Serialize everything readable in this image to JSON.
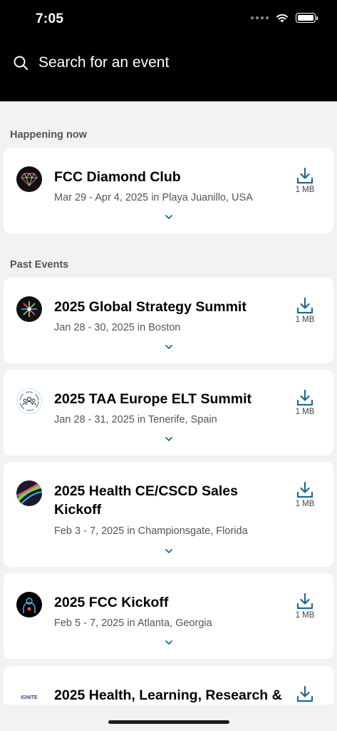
{
  "status": {
    "time": "7:05"
  },
  "search": {
    "placeholder": "Search for an event"
  },
  "sections": {
    "happening_now": "Happening now",
    "past_events": "Past Events"
  },
  "events": [
    {
      "title": "FCC Diamond Club",
      "subtitle": "Mar 29 - Apr 4, 2025 in Playa Juanillo, USA",
      "size": "1 MB",
      "logo": "diamond-logo"
    },
    {
      "title": "2025 Global Strategy Summit",
      "subtitle": "Jan 28 - 30, 2025 in Boston",
      "size": "1 MB",
      "logo": "snowflake-logo"
    },
    {
      "title": "2025 TAA Europe ELT Summit",
      "subtitle": "Jan 28 - 31, 2025 in Tenerife, Spain",
      "size": "1 MB",
      "logo": "people-logo"
    },
    {
      "title": "2025 Health CE/CSCD Sales Kickoff",
      "subtitle": "Feb 3 - 7, 2025 in Championsgate, Florida",
      "size": "1 MB",
      "logo": "light-trail-logo"
    },
    {
      "title": "2025 FCC Kickoff",
      "subtitle": "Feb 5 - 7, 2025 in Atlanta, Georgia",
      "size": "1 MB",
      "logo": "person-outline-logo"
    },
    {
      "title": "2025 Health, Learning, Research &",
      "subtitle": "",
      "size": "",
      "logo": "ignite-logo",
      "logo_text": "IGNITE"
    }
  ],
  "colors": {
    "header_bg": "#000000",
    "accent": "#1a6a96",
    "background": "#f2f2f2"
  }
}
